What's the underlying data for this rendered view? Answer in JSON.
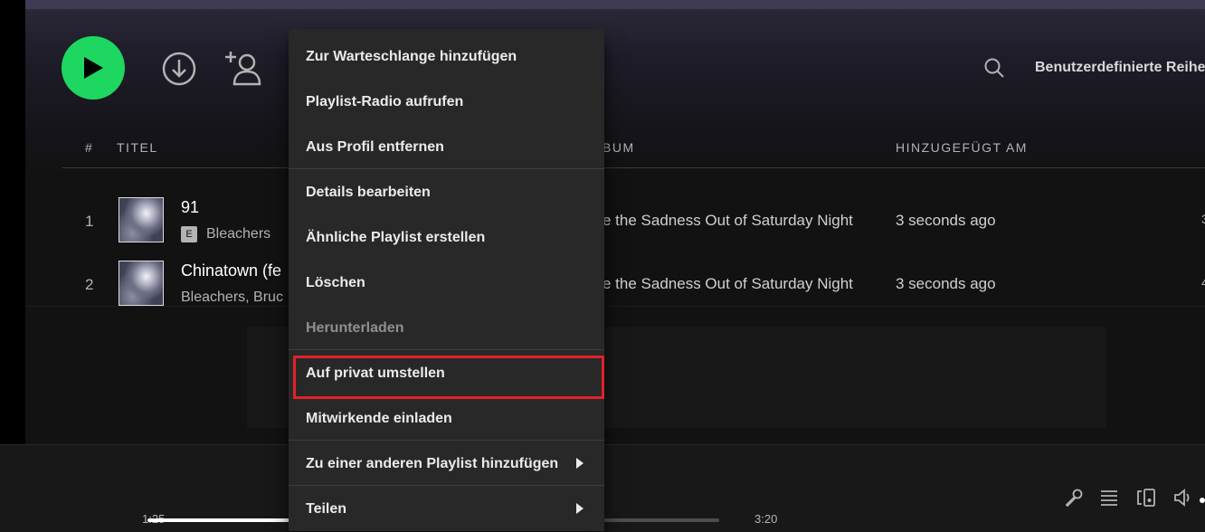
{
  "toolbar": {
    "play_icon": "play-icon",
    "download_icon": "download-icon",
    "add_user_icon": "add-user-icon",
    "search_icon": "search-icon",
    "sort_label": "Benutzerdefinierte Reihe",
    "accent_color": "#1ed760"
  },
  "columns": {
    "num": "#",
    "title": "TITEL",
    "album": "BUM",
    "added": "HINZUGEFÜGT AM"
  },
  "tracks": [
    {
      "num": "1",
      "title": "91",
      "explicit": "E",
      "artist": "Bleachers",
      "album": "e the Sadness Out of Saturday Night",
      "added": "3 seconds ago",
      "edge": "3"
    },
    {
      "num": "2",
      "title": "Chinatown (fe",
      "artist": "Bleachers, Bruc",
      "album": "e the Sadness Out of Saturday Night",
      "added": "3 seconds ago",
      "edge": "4"
    }
  ],
  "player": {
    "elapsed": "1:25",
    "duration": "3:20",
    "progress_fraction": 0.425
  },
  "context_menu": {
    "items": [
      {
        "label": "Zur Warteschlange hinzufügen"
      },
      {
        "label": "Playlist-Radio aufrufen"
      },
      {
        "label": "Aus Profil entfernen"
      },
      {
        "label": "Details bearbeiten"
      },
      {
        "label": "Ähnliche Playlist erstellen"
      },
      {
        "label": "Löschen"
      },
      {
        "label": "Herunterladen",
        "disabled": true
      },
      {
        "label": "Auf privat umstellen",
        "highlighted": true
      },
      {
        "label": "Mitwirkende einladen"
      },
      {
        "label": "Zu einer anderen Playlist hinzufügen",
        "submenu": true
      },
      {
        "label": "Teilen",
        "submenu": true
      }
    ],
    "highlight_color": "#e4202a"
  }
}
